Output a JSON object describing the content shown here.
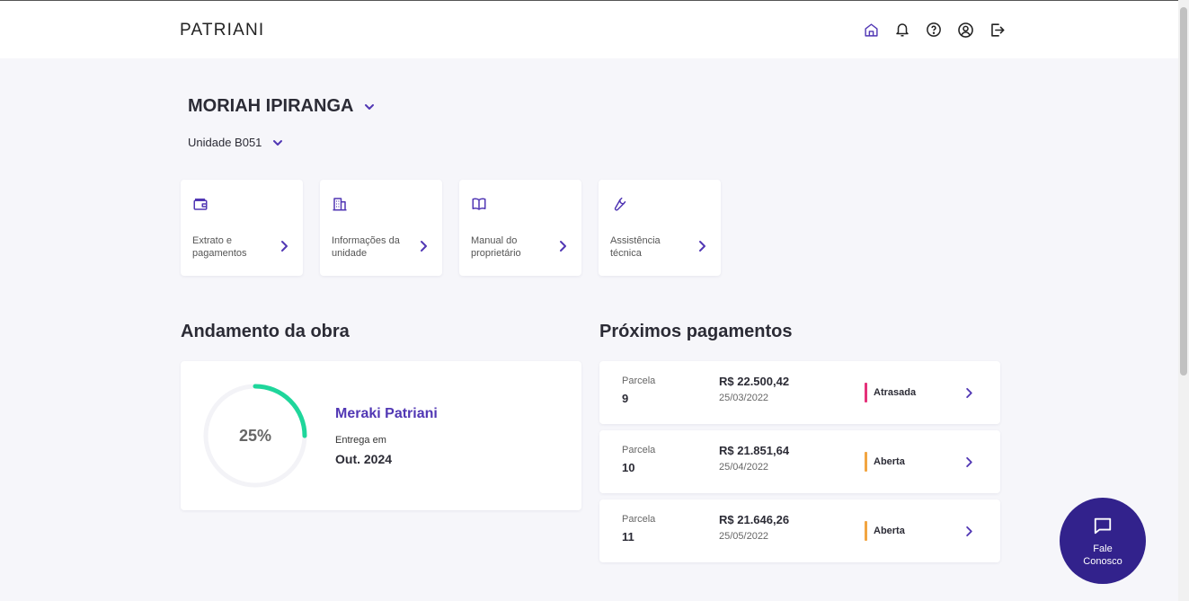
{
  "header": {
    "logo": "PATRIANI",
    "icons": [
      "home-icon",
      "bell-icon",
      "help-icon",
      "user-icon",
      "logout-icon"
    ]
  },
  "project": {
    "title": "MORIAH IPIRANGA",
    "unit": "Unidade B051"
  },
  "quick_links": [
    {
      "label": "Extrato e pagamentos",
      "icon": "wallet-icon"
    },
    {
      "label": "Informações da unidade",
      "icon": "building-icon"
    },
    {
      "label": "Manual do proprietário",
      "icon": "book-icon"
    },
    {
      "label": "Assistência técnica",
      "icon": "wrench-icon"
    }
  ],
  "progress": {
    "section_title": "Andamento da obra",
    "percent_label": "25%",
    "percent_value": 0.25,
    "project_name": "Meraki Patriani",
    "delivery_label": "Entrega em",
    "delivery_date": "Out. 2024"
  },
  "payments": {
    "section_title": "Próximos pagamentos",
    "rows": [
      {
        "label": "Parcela",
        "number": "9",
        "amount": "R$ 22.500,42",
        "date": "25/03/2022",
        "status": "Atrasada",
        "status_color": "#e5317a"
      },
      {
        "label": "Parcela",
        "number": "10",
        "amount": "R$ 21.851,64",
        "date": "25/04/2022",
        "status": "Aberta",
        "status_color": "#f2a541"
      },
      {
        "label": "Parcela",
        "number": "11",
        "amount": "R$ 21.646,26",
        "date": "25/05/2022",
        "status": "Aberta",
        "status_color": "#f2a541"
      }
    ]
  },
  "contact_button": {
    "line1": "Fale",
    "line2": "Conosco",
    "icon": "chat-icon"
  },
  "colors": {
    "accent": "#5137b4",
    "fab": "#32228c",
    "progress": "#1fd69b",
    "background": "#f6f6fa"
  }
}
